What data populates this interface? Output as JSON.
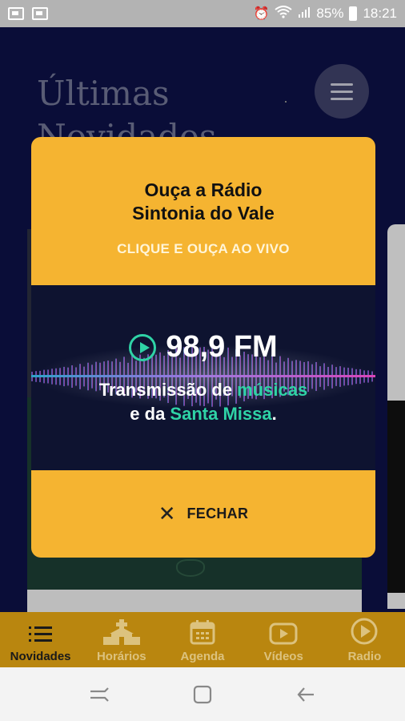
{
  "status_bar": {
    "icons_left": [
      "voicemail-icon",
      "image-icon"
    ],
    "battery": "85%",
    "time": "18:21",
    "icons_right": [
      "alarm-icon",
      "wifi-icon",
      "signal-icon",
      "battery-icon"
    ]
  },
  "page": {
    "title": "Últimas Novidades",
    "menu_icon": "hamburger-icon"
  },
  "modal": {
    "title": "Ouça a Rádio\nSintonia do Vale",
    "cta": "CLIQUE E OUÇA AO VIVO",
    "frequency": "98,9 FM",
    "tagline_part1": "Transmissão de ",
    "tagline_highlight1": "músicas",
    "tagline_part2": "e da ",
    "tagline_highlight2": "Santa Missa",
    "tagline_end": ".",
    "close_label": "FECHAR",
    "colors": {
      "background": "#f5b431",
      "accent": "#2fd3a6",
      "banner": "#0e1330"
    }
  },
  "tabbar": {
    "active": "Novidades",
    "tabs": [
      {
        "label": "Novidades",
        "icon": "list-icon"
      },
      {
        "label": "Horários",
        "icon": "church-icon"
      },
      {
        "label": "Agenda",
        "icon": "calendar-icon"
      },
      {
        "label": "Vídeos",
        "icon": "video-icon"
      },
      {
        "label": "Radio",
        "icon": "play-circle-icon"
      }
    ]
  },
  "navbar": {
    "buttons": [
      "recent-apps-icon",
      "home-icon",
      "back-icon"
    ]
  }
}
